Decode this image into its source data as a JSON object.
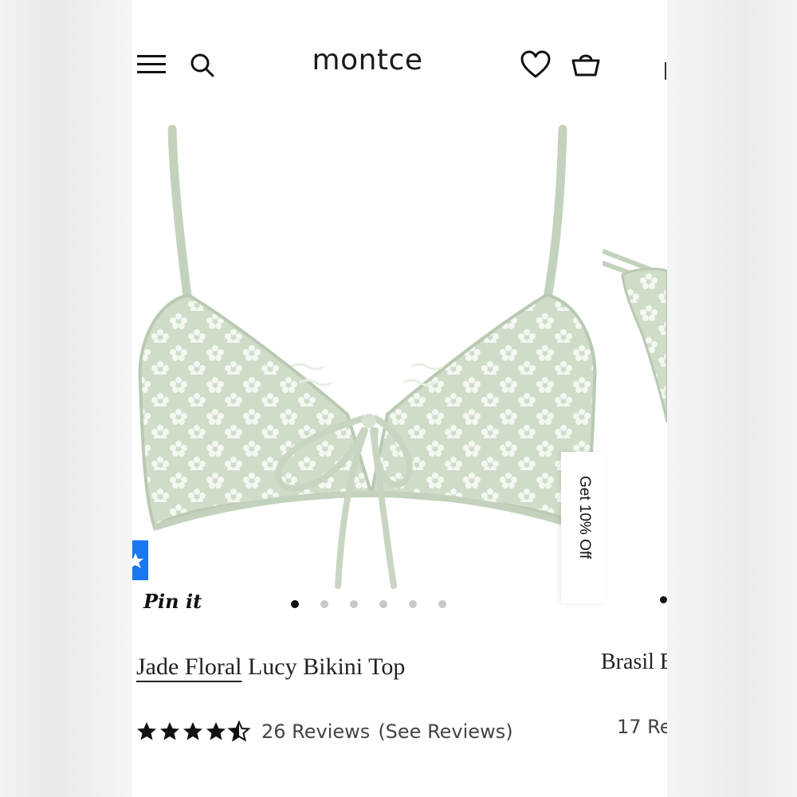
{
  "header": {
    "brand": "montce",
    "icons": [
      "menu-icon",
      "search-icon",
      "heart-icon",
      "basket-icon"
    ]
  },
  "gallery": {
    "pin_label": "Pin it",
    "slide_count": 6,
    "active_slide": 1
  },
  "promo": {
    "label": "Get 10% Off"
  },
  "product": {
    "title_underlined": "Jade Floral",
    "title_rest": " Lucy Bikini Top",
    "rating": 4.5,
    "reviews_label": "26 Reviews",
    "see_reviews_label": "(See Reviews)"
  },
  "next_product": {
    "title": "Brasil Bi",
    "reviews_label": "17 Re"
  },
  "colors": {
    "fabric": "#cfdcc8",
    "fabric_shadow": "#b9c9b2",
    "flower": "#f4f7f2",
    "share_blue": "#1877f2"
  }
}
